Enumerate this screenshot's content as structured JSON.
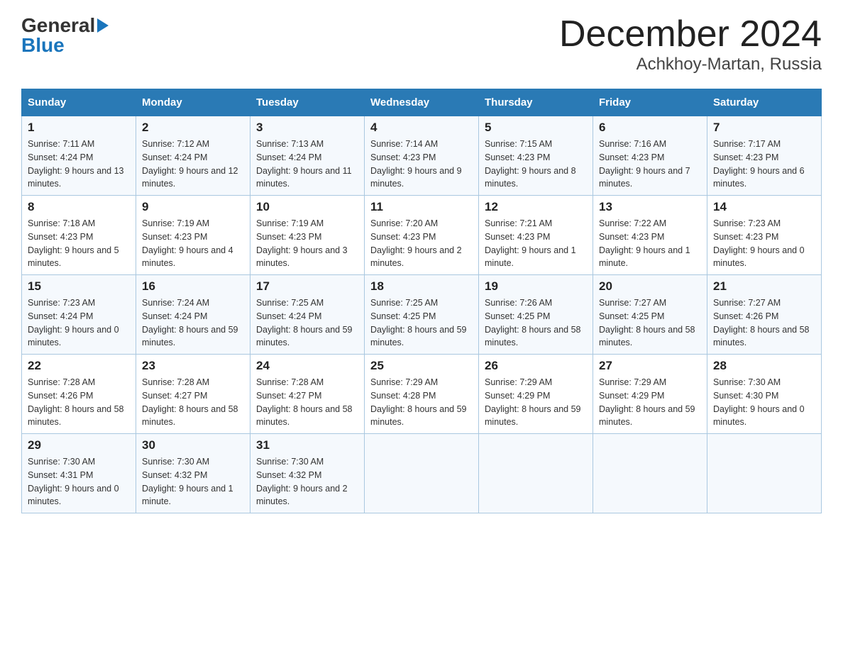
{
  "header": {
    "logo_general": "General",
    "logo_blue": "Blue",
    "month_title": "December 2024",
    "location": "Achkhoy-Martan, Russia"
  },
  "days_of_week": [
    "Sunday",
    "Monday",
    "Tuesday",
    "Wednesday",
    "Thursday",
    "Friday",
    "Saturday"
  ],
  "weeks": [
    [
      {
        "num": "1",
        "sunrise": "7:11 AM",
        "sunset": "4:24 PM",
        "daylight": "9 hours and 13 minutes."
      },
      {
        "num": "2",
        "sunrise": "7:12 AM",
        "sunset": "4:24 PM",
        "daylight": "9 hours and 12 minutes."
      },
      {
        "num": "3",
        "sunrise": "7:13 AM",
        "sunset": "4:24 PM",
        "daylight": "9 hours and 11 minutes."
      },
      {
        "num": "4",
        "sunrise": "7:14 AM",
        "sunset": "4:23 PM",
        "daylight": "9 hours and 9 minutes."
      },
      {
        "num": "5",
        "sunrise": "7:15 AM",
        "sunset": "4:23 PM",
        "daylight": "9 hours and 8 minutes."
      },
      {
        "num": "6",
        "sunrise": "7:16 AM",
        "sunset": "4:23 PM",
        "daylight": "9 hours and 7 minutes."
      },
      {
        "num": "7",
        "sunrise": "7:17 AM",
        "sunset": "4:23 PM",
        "daylight": "9 hours and 6 minutes."
      }
    ],
    [
      {
        "num": "8",
        "sunrise": "7:18 AM",
        "sunset": "4:23 PM",
        "daylight": "9 hours and 5 minutes."
      },
      {
        "num": "9",
        "sunrise": "7:19 AM",
        "sunset": "4:23 PM",
        "daylight": "9 hours and 4 minutes."
      },
      {
        "num": "10",
        "sunrise": "7:19 AM",
        "sunset": "4:23 PM",
        "daylight": "9 hours and 3 minutes."
      },
      {
        "num": "11",
        "sunrise": "7:20 AM",
        "sunset": "4:23 PM",
        "daylight": "9 hours and 2 minutes."
      },
      {
        "num": "12",
        "sunrise": "7:21 AM",
        "sunset": "4:23 PM",
        "daylight": "9 hours and 1 minute."
      },
      {
        "num": "13",
        "sunrise": "7:22 AM",
        "sunset": "4:23 PM",
        "daylight": "9 hours and 1 minute."
      },
      {
        "num": "14",
        "sunrise": "7:23 AM",
        "sunset": "4:23 PM",
        "daylight": "9 hours and 0 minutes."
      }
    ],
    [
      {
        "num": "15",
        "sunrise": "7:23 AM",
        "sunset": "4:24 PM",
        "daylight": "9 hours and 0 minutes."
      },
      {
        "num": "16",
        "sunrise": "7:24 AM",
        "sunset": "4:24 PM",
        "daylight": "8 hours and 59 minutes."
      },
      {
        "num": "17",
        "sunrise": "7:25 AM",
        "sunset": "4:24 PM",
        "daylight": "8 hours and 59 minutes."
      },
      {
        "num": "18",
        "sunrise": "7:25 AM",
        "sunset": "4:25 PM",
        "daylight": "8 hours and 59 minutes."
      },
      {
        "num": "19",
        "sunrise": "7:26 AM",
        "sunset": "4:25 PM",
        "daylight": "8 hours and 58 minutes."
      },
      {
        "num": "20",
        "sunrise": "7:27 AM",
        "sunset": "4:25 PM",
        "daylight": "8 hours and 58 minutes."
      },
      {
        "num": "21",
        "sunrise": "7:27 AM",
        "sunset": "4:26 PM",
        "daylight": "8 hours and 58 minutes."
      }
    ],
    [
      {
        "num": "22",
        "sunrise": "7:28 AM",
        "sunset": "4:26 PM",
        "daylight": "8 hours and 58 minutes."
      },
      {
        "num": "23",
        "sunrise": "7:28 AM",
        "sunset": "4:27 PM",
        "daylight": "8 hours and 58 minutes."
      },
      {
        "num": "24",
        "sunrise": "7:28 AM",
        "sunset": "4:27 PM",
        "daylight": "8 hours and 58 minutes."
      },
      {
        "num": "25",
        "sunrise": "7:29 AM",
        "sunset": "4:28 PM",
        "daylight": "8 hours and 59 minutes."
      },
      {
        "num": "26",
        "sunrise": "7:29 AM",
        "sunset": "4:29 PM",
        "daylight": "8 hours and 59 minutes."
      },
      {
        "num": "27",
        "sunrise": "7:29 AM",
        "sunset": "4:29 PM",
        "daylight": "8 hours and 59 minutes."
      },
      {
        "num": "28",
        "sunrise": "7:30 AM",
        "sunset": "4:30 PM",
        "daylight": "9 hours and 0 minutes."
      }
    ],
    [
      {
        "num": "29",
        "sunrise": "7:30 AM",
        "sunset": "4:31 PM",
        "daylight": "9 hours and 0 minutes."
      },
      {
        "num": "30",
        "sunrise": "7:30 AM",
        "sunset": "4:32 PM",
        "daylight": "9 hours and 1 minute."
      },
      {
        "num": "31",
        "sunrise": "7:30 AM",
        "sunset": "4:32 PM",
        "daylight": "9 hours and 2 minutes."
      },
      null,
      null,
      null,
      null
    ]
  ]
}
